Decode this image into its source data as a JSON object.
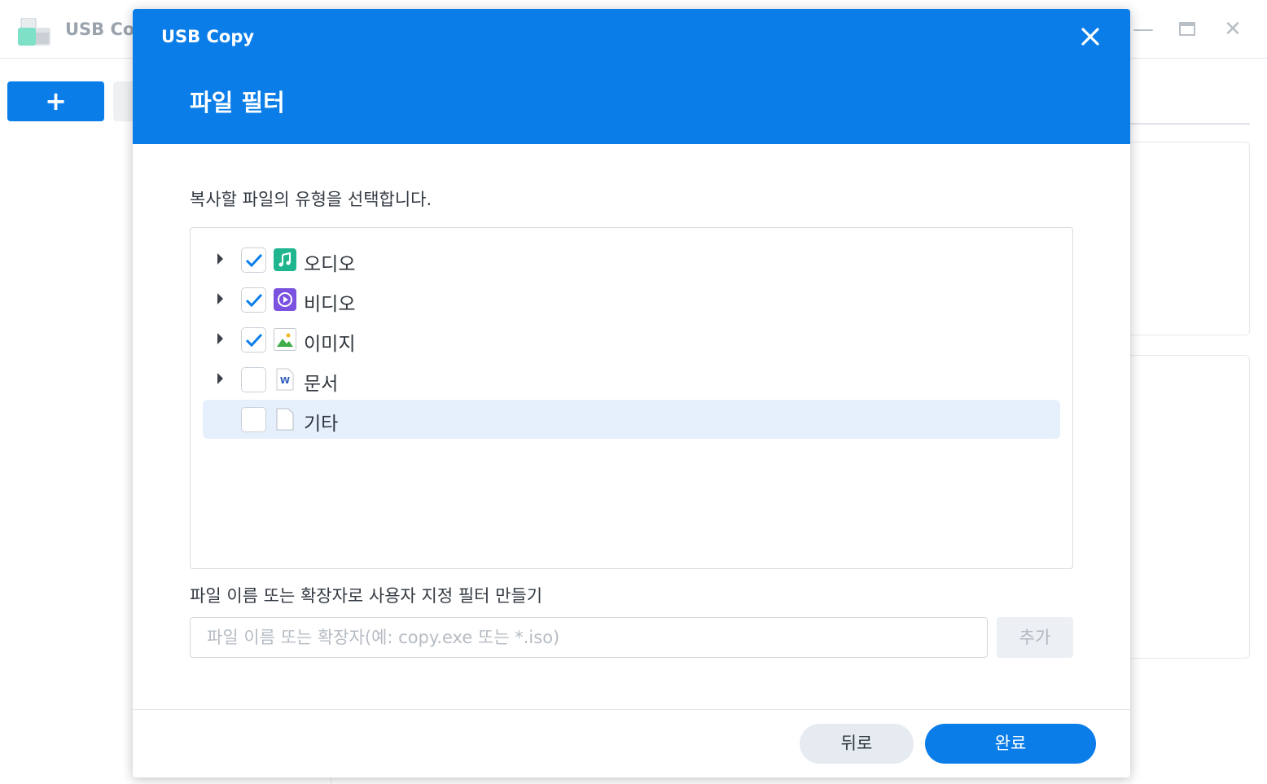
{
  "app": {
    "title": "USB Co",
    "add_label": "+",
    "window_controls": [
      "minimize-icon",
      "maximize-icon",
      "close-icon"
    ]
  },
  "dialog": {
    "app_title": "USB Copy",
    "close_icon": "close-icon",
    "heading": "파일 필터",
    "description": "복사할 파일의 유형을 선택합니다.",
    "file_types": [
      {
        "label": "오디오",
        "checked": true,
        "expandable": true,
        "icon": "audio-icon",
        "icon_color": "#1fb58f"
      },
      {
        "label": "비디오",
        "checked": true,
        "expandable": true,
        "icon": "video-icon",
        "icon_color": "#7b52e0"
      },
      {
        "label": "이미지",
        "checked": true,
        "expandable": true,
        "icon": "image-icon",
        "icon_color": "#3fae4a"
      },
      {
        "label": "문서",
        "checked": false,
        "expandable": true,
        "icon": "document-icon",
        "icon_color": "#2b5bbd"
      },
      {
        "label": "기타",
        "checked": false,
        "expandable": false,
        "icon": "file-icon",
        "icon_color": "#b8bec5",
        "selected": true
      }
    ],
    "custom_filter_label": "파일 이름 또는 확장자로 사용자 지정 필터 만들기",
    "custom_filter_placeholder": "파일 이름 또는 확장자(예: copy.exe 또는 *.iso)",
    "add_button": "추가",
    "back_button": "뒤로",
    "done_button": "완료",
    "accent_color": "#0a7de9"
  }
}
